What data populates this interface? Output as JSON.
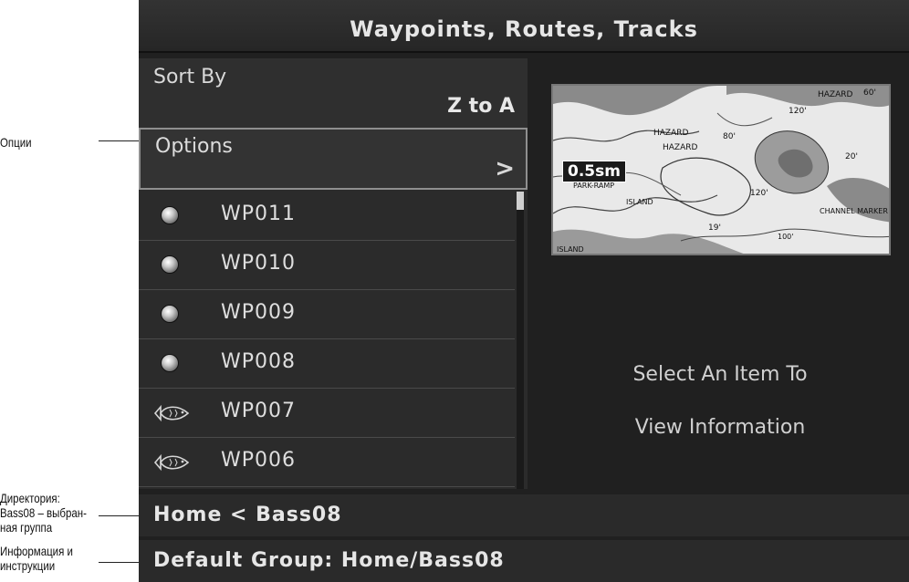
{
  "callouts": {
    "options": "Опции",
    "directory_line1": "Директория:",
    "directory_line2": "Bass08 – выбран-",
    "directory_line3": "ная группа",
    "info_line1": "Информация и",
    "info_line2": "инструкции"
  },
  "header": {
    "title": "Waypoints, Routes, Tracks"
  },
  "sort": {
    "label": "Sort By",
    "value": "Z to A"
  },
  "options": {
    "label": "Options",
    "chevron": ">"
  },
  "list": {
    "items": [
      {
        "label": "WP011",
        "icon": "waypoint-dot-icon"
      },
      {
        "label": "WP010",
        "icon": "waypoint-dot-icon"
      },
      {
        "label": "WP009",
        "icon": "waypoint-dot-icon"
      },
      {
        "label": "WP008",
        "icon": "waypoint-dot-icon"
      },
      {
        "label": "WP007",
        "icon": "fish-icon"
      },
      {
        "label": "WP006",
        "icon": "fish-icon"
      }
    ]
  },
  "map": {
    "scale": "0.5sm",
    "labels": [
      "HAZARD",
      "HAZARD",
      "HAZARD",
      "120'",
      "80'",
      "60'",
      "20'",
      "19'",
      "120'",
      "PARK-RAMP",
      "ISLAND",
      "ISLAND",
      "CHANNEL MARKER",
      "100'"
    ]
  },
  "info": {
    "line1": "Select An Item To",
    "line2": "View Information"
  },
  "path": {
    "text": "Home < Bass08"
  },
  "status": {
    "text": "Default Group: Home/Bass08"
  },
  "colors": {
    "screen_bg": "#202020",
    "text": "#e6e6e6",
    "highlight_border": "#8f8f8f"
  }
}
